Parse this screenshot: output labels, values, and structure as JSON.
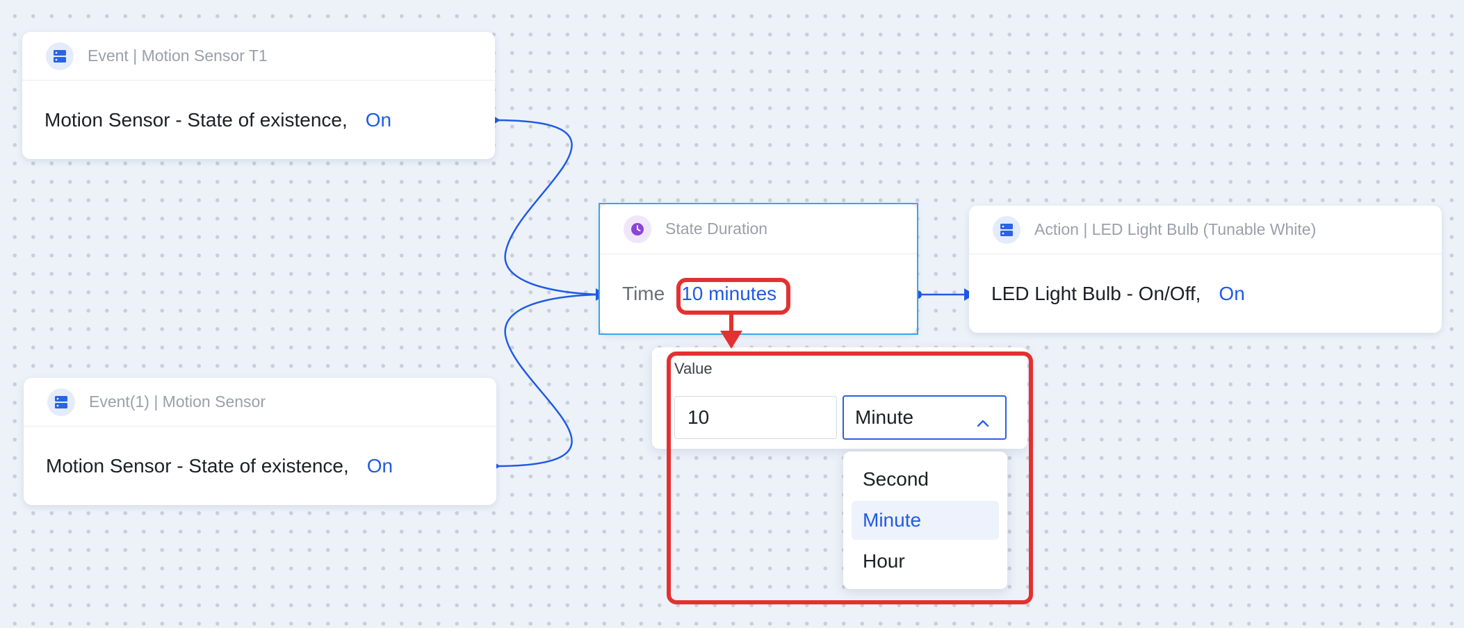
{
  "nodes": {
    "event1": {
      "header": "Event | Motion Sensor T1",
      "condition": "Motion Sensor - State of existence,",
      "value": "On"
    },
    "event2": {
      "header": "Event(1) | Motion Sensor",
      "condition": "Motion Sensor - State of existence,",
      "value": "On"
    },
    "duration": {
      "header": "State Duration",
      "label": "Time",
      "value": "10 minutes"
    },
    "action": {
      "header": "Action | LED Light Bulb (Tunable White)",
      "condition": "LED Light Bulb - On/Off,",
      "value": "On"
    }
  },
  "popover": {
    "label": "Value",
    "number": "10",
    "unit": "Minute",
    "options": [
      "Second",
      "Minute",
      "Hour"
    ],
    "selected_option": "Minute"
  },
  "colors": {
    "accent": "#1f5be6",
    "highlight": "#e53030",
    "selection": "#38a5ec"
  },
  "icons": {
    "device": "device-icon",
    "clock": "clock-icon",
    "chevron": "chevron-up-icon"
  }
}
